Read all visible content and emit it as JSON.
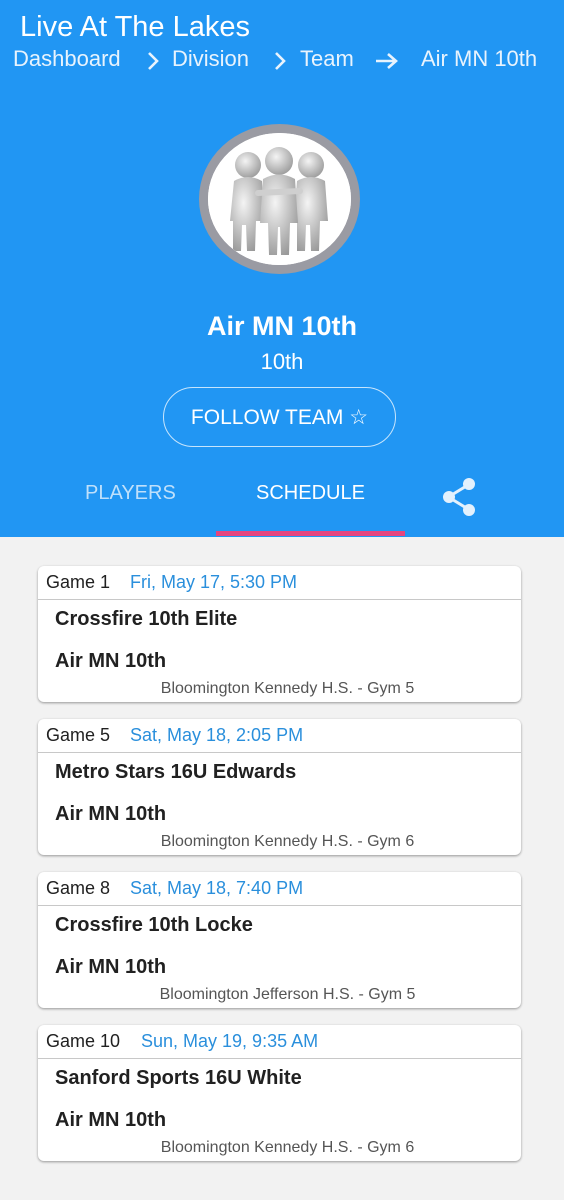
{
  "app": {
    "title": "Live At The Lakes"
  },
  "breadcrumb": {
    "items": [
      "Dashboard",
      "Division",
      "Team"
    ],
    "current": "Air MN 10th"
  },
  "team": {
    "name": "Air MN 10th",
    "subtitle": "10th",
    "follow_label": "FOLLOW TEAM ☆"
  },
  "tabs": {
    "players": "PLAYERS",
    "schedule": "SCHEDULE"
  },
  "colors": {
    "header": "#2196f3",
    "accent_underline": "#e5457f",
    "date_text": "#2a8fdc"
  },
  "games": [
    {
      "game": "Game 1",
      "date": "Fri, May 17, 5:30 PM",
      "team1": "Crossfire 10th Elite",
      "team2": "Air MN 10th",
      "venue": "Bloomington Kennedy H.S. - Gym 5"
    },
    {
      "game": "Game 5",
      "date": "Sat, May 18, 2:05 PM",
      "team1": "Metro Stars 16U Edwards",
      "team2": "Air MN 10th",
      "venue": "Bloomington Kennedy H.S. - Gym 6"
    },
    {
      "game": "Game 8",
      "date": "Sat, May 18, 7:40 PM",
      "team1": "Crossfire 10th Locke",
      "team2": "Air MN 10th",
      "venue": "Bloomington Jefferson H.S. - Gym 5"
    },
    {
      "game": "Game 10",
      "date": "Sun, May 19, 9:35 AM",
      "team1": "Sanford Sports 16U White",
      "team2": "Air MN 10th",
      "venue": "Bloomington Kennedy H.S. - Gym 6"
    }
  ]
}
